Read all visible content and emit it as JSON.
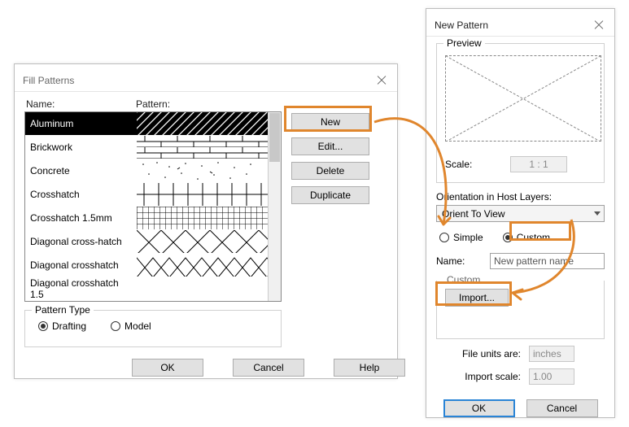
{
  "fill_patterns": {
    "title": "Fill Patterns",
    "name_header": "Name:",
    "pattern_header": "Pattern:",
    "rows": [
      {
        "name": "Aluminum"
      },
      {
        "name": "Brickwork"
      },
      {
        "name": "Concrete"
      },
      {
        "name": "Crosshatch"
      },
      {
        "name": "Crosshatch 1.5mm"
      },
      {
        "name": "Diagonal cross-hatch"
      },
      {
        "name": "Diagonal crosshatch"
      },
      {
        "name": "Diagonal crosshatch 1.5"
      }
    ],
    "buttons": {
      "new": "New",
      "edit": "Edit...",
      "delete": "Delete",
      "duplicate": "Duplicate"
    },
    "pattern_type_legend": "Pattern Type",
    "drafting": "Drafting",
    "model": "Model",
    "ok": "OK",
    "cancel": "Cancel",
    "help": "Help"
  },
  "new_pattern": {
    "title": "New Pattern",
    "preview": "Preview",
    "scale_label": "Scale:",
    "scale_value": "1 : 1",
    "orientation_label": "Orientation in Host Layers:",
    "orientation_value": "Orient To View",
    "simple": "Simple",
    "custom": "Custom",
    "name_label": "Name:",
    "name_value": "New pattern name",
    "custom_legend": "Custom",
    "import": "Import...",
    "file_units_label": "File units are:",
    "file_units_value": "inches",
    "import_scale_label": "Import scale:",
    "import_scale_value": "1.00",
    "ok": "OK",
    "cancel": "Cancel"
  }
}
